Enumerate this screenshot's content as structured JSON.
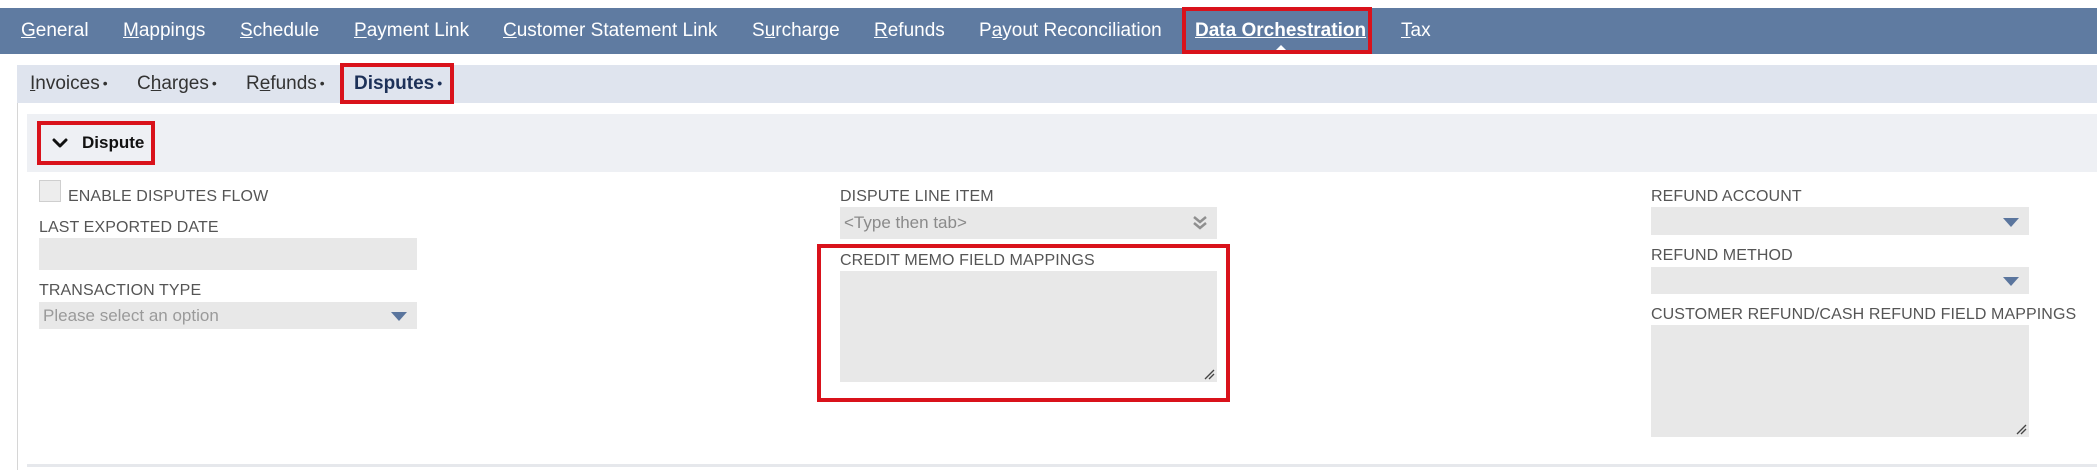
{
  "main_tabs": [
    {
      "label": "General",
      "ul": "G",
      "rest": "eneral"
    },
    {
      "label": "Mappings",
      "ul": "M",
      "rest": "appings"
    },
    {
      "label": "Schedule",
      "ul": "S",
      "rest": "chedule"
    },
    {
      "label": "Payment Link",
      "ul": "P",
      "rest": "ayment Link"
    },
    {
      "label": "Customer Statement Link",
      "ul": "C",
      "rest": "ustomer Statement Link"
    },
    {
      "pre": "S",
      "ul": "u",
      "rest": "rcharge",
      "label": "Surcharge"
    },
    {
      "label": "Refunds",
      "ul": "R",
      "rest": "efunds"
    },
    {
      "pre": "P",
      "ul": "a",
      "rest": "yout Reconciliation",
      "label": "Payout Reconciliation"
    },
    {
      "label": "Data Orchestration",
      "ul": "D",
      "rest": "ata Orchestration"
    },
    {
      "label": "Tax",
      "ul": "T",
      "rest": "ax"
    }
  ],
  "sub_tabs": [
    {
      "label": "Invoices",
      "ul": "I",
      "rest": "nvoices"
    },
    {
      "pre": "C",
      "ul": "h",
      "rest": "arges",
      "label": "Charges"
    },
    {
      "pre": "R",
      "ul": "e",
      "rest": "funds",
      "label": "Refunds"
    },
    {
      "label": "Disputes"
    }
  ],
  "sub_tab_dot": "•",
  "section": {
    "title": "Dispute"
  },
  "fields": {
    "enable_disputes_flow": "ENABLE DISPUTES FLOW",
    "last_exported_date": "LAST EXPORTED DATE",
    "transaction_type": "TRANSACTION TYPE",
    "transaction_type_placeholder": "Please select an option",
    "dispute_line_item": "DISPUTE LINE ITEM",
    "dispute_line_item_placeholder": "<Type then tab>",
    "credit_memo_field_mappings": "CREDIT MEMO FIELD MAPPINGS",
    "refund_account": "REFUND ACCOUNT",
    "refund_method": "REFUND METHOD",
    "customer_refund_mappings": "CUSTOMER REFUND/CASH REFUND FIELD MAPPINGS"
  },
  "colors": {
    "tab_bar": "#5f7ba1",
    "sub_bar": "#dfe4ee",
    "highlight": "#d9121b",
    "field_bg": "#e8e8e8"
  }
}
